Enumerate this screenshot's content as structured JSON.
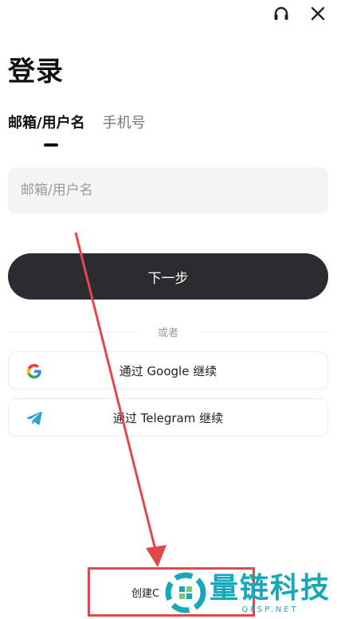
{
  "header": {
    "support_icon": "headset-icon",
    "close_icon": "close-icon"
  },
  "title": "登录",
  "tabs": [
    {
      "label": "邮箱/用户名",
      "active": true
    },
    {
      "label": "手机号",
      "active": false
    }
  ],
  "login_field": {
    "placeholder": "邮箱/用户名",
    "value": ""
  },
  "next_button": {
    "label": "下一步"
  },
  "divider": {
    "label": "或者"
  },
  "social": {
    "google": {
      "label": "通过 Google 继续",
      "icon": "google-icon"
    },
    "telegram": {
      "label": "通过 Telegram 继续",
      "icon": "telegram-icon"
    }
  },
  "footer": {
    "create_account": "创建C"
  },
  "watermark": {
    "name": "量链科技",
    "domain": "QFSP.NET"
  },
  "colors": {
    "primary_button": "#2c2c30",
    "annotation_red": "#e3474b",
    "watermark": "#16a8b8"
  }
}
